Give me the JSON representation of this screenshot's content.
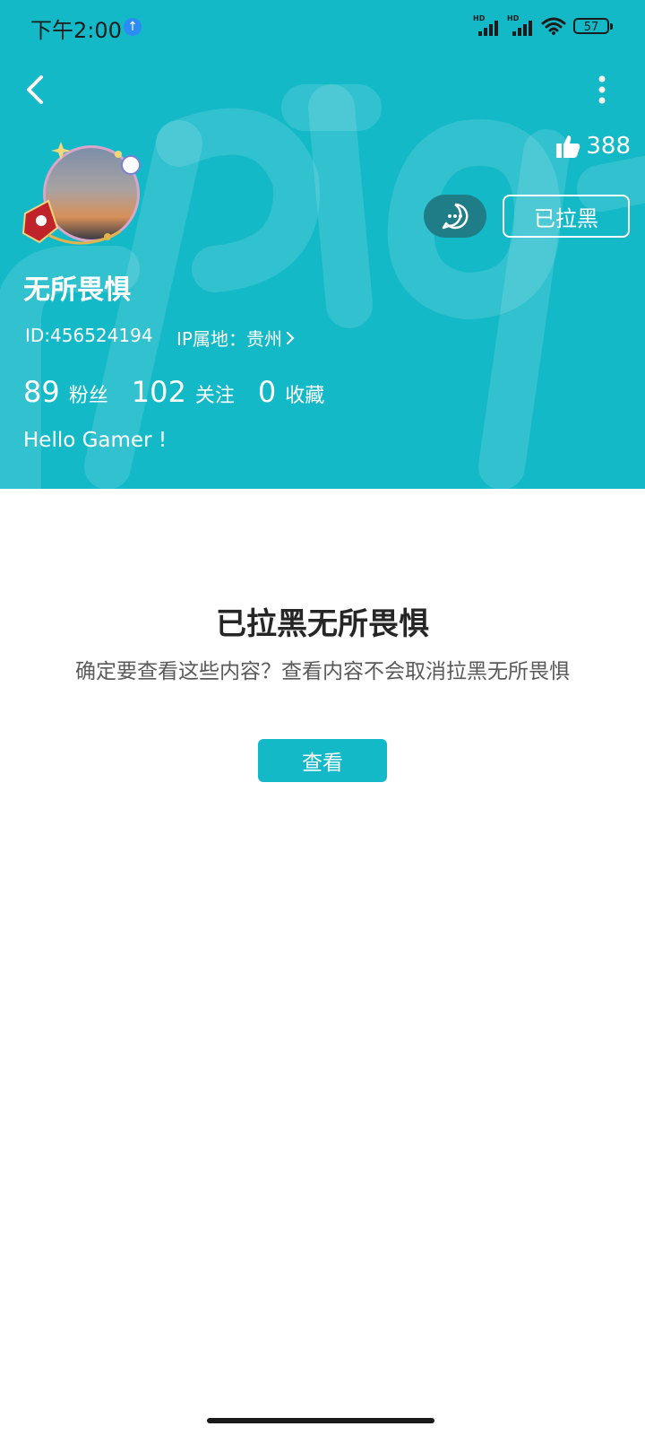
{
  "status_bar": {
    "time": "下午2:00",
    "upload_icon": "arrow-up-icon",
    "battery": "57",
    "signal_label": "HD"
  },
  "header": {
    "likes_count": "388",
    "block_button_label": "已拉黑",
    "username": "无所畏惧",
    "id_text": "ID:456524194",
    "ip_text": "IP属地：贵州",
    "stats": [
      {
        "value": "89",
        "label": "粉丝"
      },
      {
        "value": "102",
        "label": "关注"
      },
      {
        "value": "0",
        "label": "收藏"
      }
    ],
    "bio": "Hello Gamer !"
  },
  "blocked_notice": {
    "title": "已拉黑无所畏惧",
    "description": "确定要查看这些内容？查看内容不会取消拉黑无所畏惧",
    "view_button_label": "查看"
  },
  "colors": {
    "brand": "#14b9c8",
    "chat_button": "#1f7d87"
  }
}
